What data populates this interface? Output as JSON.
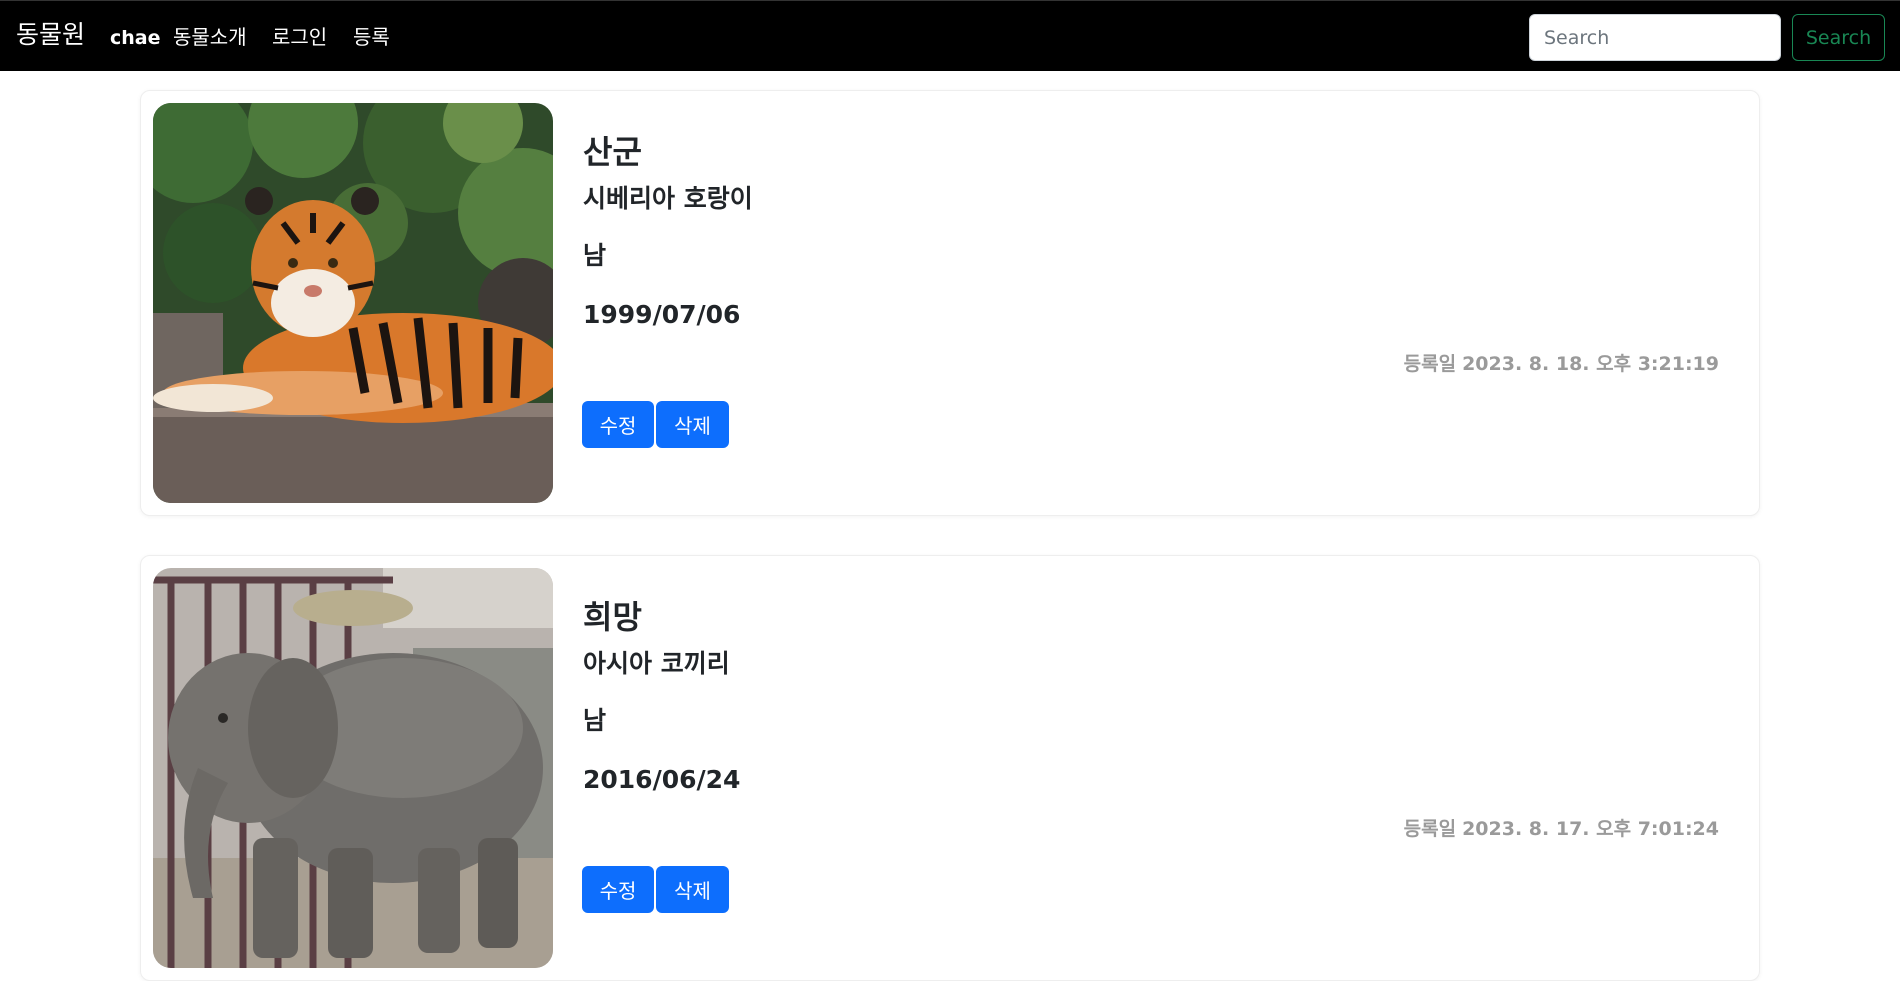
{
  "navbar": {
    "brand": "동물원",
    "user": "chae",
    "links": {
      "about": "동물소개",
      "login": "로그인",
      "register": "등록"
    },
    "search": {
      "placeholder": "Search",
      "value": "",
      "button_label": "Search"
    }
  },
  "colors": {
    "navbar_bg": "#000000",
    "primary_button": "#0d6efd",
    "search_button": "#198754",
    "muted_text": "#9a9a9a"
  },
  "animals": [
    {
      "name": "산군",
      "species": "시베리아 호랑이",
      "gender": "남",
      "birth": "1999/07/06",
      "registered_label": "등록일",
      "registered_at": "2023. 8. 18. 오후 3:21:19",
      "edit_label": "수정",
      "delete_label": "삭제",
      "photo": "tiger-photo"
    },
    {
      "name": "희망",
      "species": "아시아 코끼리",
      "gender": "남",
      "birth": "2016/06/24",
      "registered_label": "등록일",
      "registered_at": "2023. 8. 17. 오후 7:01:24",
      "edit_label": "수정",
      "delete_label": "삭제",
      "photo": "elephant-photo"
    }
  ]
}
